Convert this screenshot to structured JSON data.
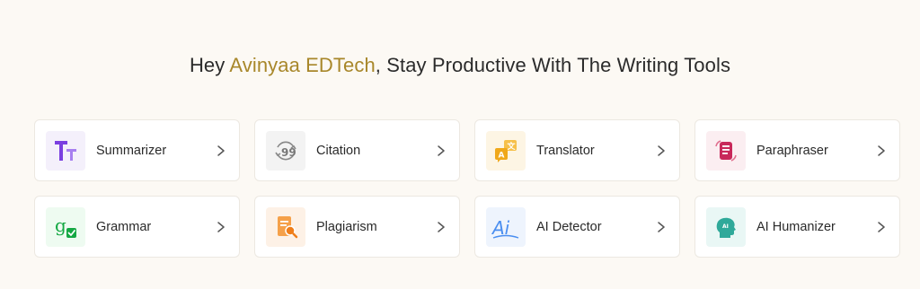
{
  "header": {
    "prefix": "Hey ",
    "brand": "Avinyaa EDTech",
    "suffix": ", Stay Productive With The Writing Tools"
  },
  "tools": [
    {
      "label": "Summarizer",
      "icon": "text-size-icon",
      "bg": "#f4f0fb"
    },
    {
      "label": "Citation",
      "icon": "citation-icon",
      "bg": "#f3f3f3"
    },
    {
      "label": "Translator",
      "icon": "translate-icon",
      "bg": "#fdf5e4"
    },
    {
      "label": "Paraphraser",
      "icon": "paraphrase-icon",
      "bg": "#fbeef1"
    },
    {
      "label": "Grammar",
      "icon": "grammar-icon",
      "bg": "#eefbf1"
    },
    {
      "label": "Plagiarism",
      "icon": "plagiarism-icon",
      "bg": "#fdf1e6"
    },
    {
      "label": "AI Detector",
      "icon": "ai-detector-icon",
      "bg": "#eef4fd"
    },
    {
      "label": "AI Humanizer",
      "icon": "ai-humanizer-icon",
      "bg": "#e9f7f5"
    }
  ]
}
